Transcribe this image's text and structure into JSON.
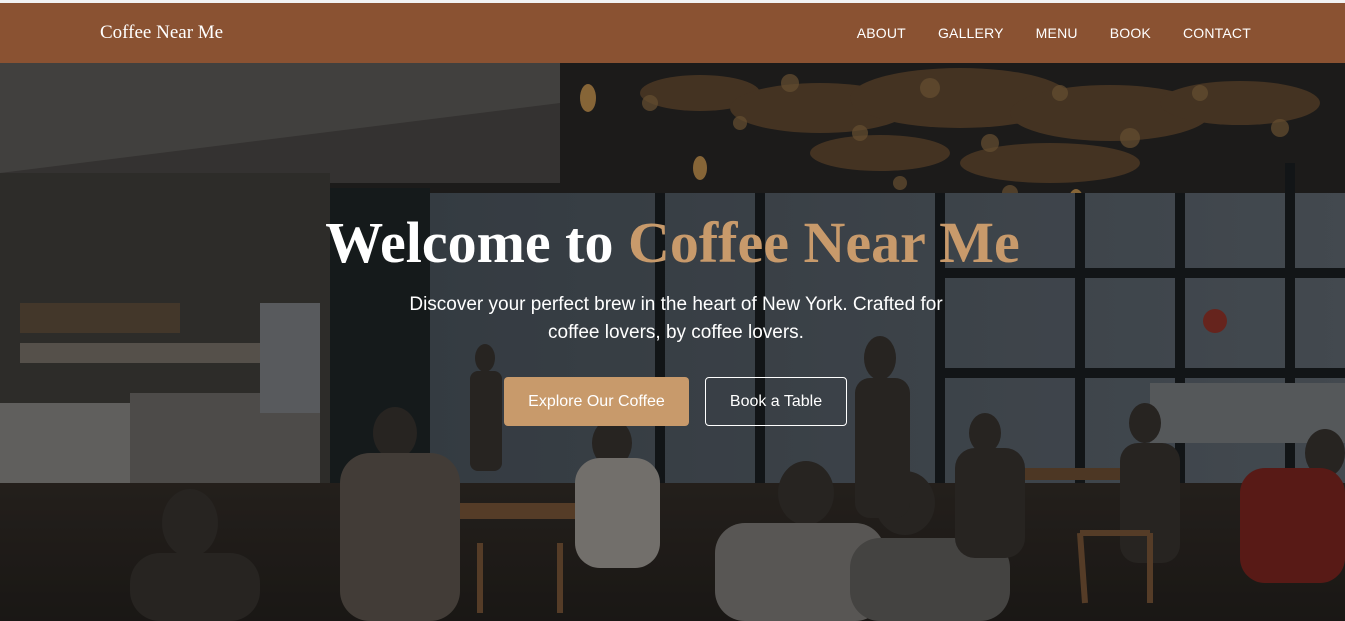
{
  "header": {
    "brand": "Coffee Near Me",
    "nav": [
      "ABOUT",
      "GALLERY",
      "MENU",
      "BOOK",
      "CONTACT"
    ]
  },
  "hero": {
    "title_prefix": "Welcome to",
    "title_accent": "Coffee Near Me",
    "subtitle": "Discover your perfect brew in the heart of New York. Crafted for coffee lovers, by coffee lovers.",
    "primary_button": "Explore Our Coffee",
    "secondary_button": "Book a Table"
  },
  "colors": {
    "navbar": "#8a5232",
    "accent": "#c89a6b",
    "text": "#ffffff"
  }
}
